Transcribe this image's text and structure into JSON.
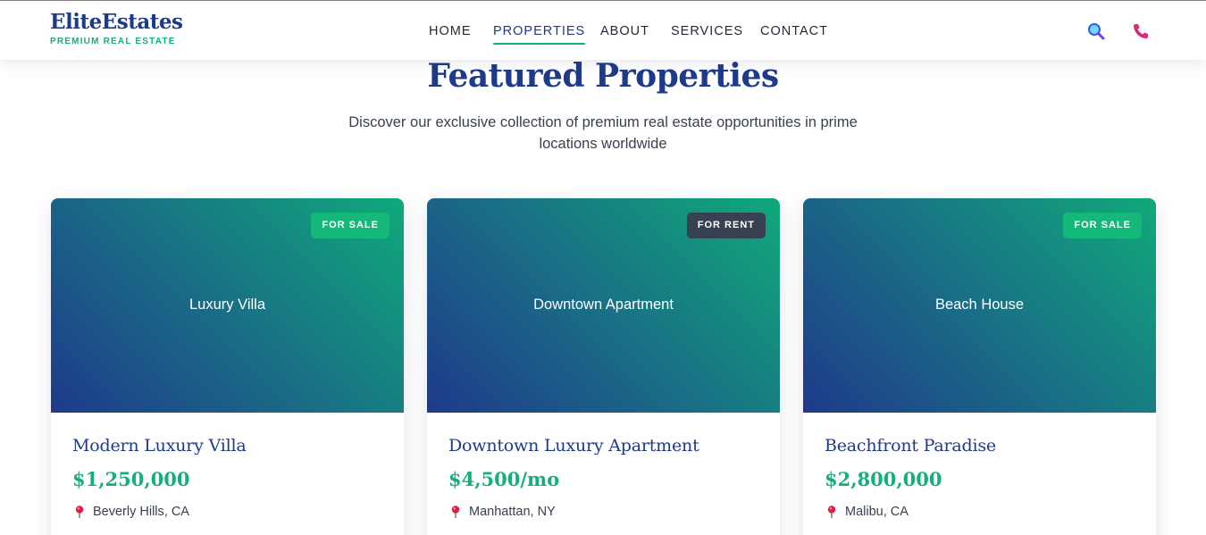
{
  "brand": {
    "name": "EliteEstates",
    "tagline": "PREMIUM REAL ESTATE"
  },
  "nav": {
    "items": [
      {
        "label": "HOME",
        "active": false
      },
      {
        "label": "PROPERTIES",
        "active": true
      },
      {
        "label": "ABOUT",
        "active": false
      },
      {
        "label": "SERVICES",
        "active": false
      },
      {
        "label": "CONTACT",
        "active": false
      }
    ],
    "icons": [
      "search-icon",
      "phone-icon"
    ]
  },
  "section": {
    "title": "Featured Properties",
    "description": "Discover our exclusive collection of premium real estate opportunities in prime locations worldwide"
  },
  "properties": [
    {
      "image_label": "Luxury Villa",
      "badge": "FOR SALE",
      "title": "Modern Luxury Villa",
      "price": "$1,250,000",
      "location": "Beverly Hills, CA"
    },
    {
      "image_label": "Downtown Apartment",
      "badge": "FOR RENT",
      "title": "Downtown Luxury Apartment",
      "price": "$4,500/mo",
      "location": "Manhattan, NY"
    },
    {
      "image_label": "Beach House",
      "badge": "FOR SALE",
      "title": "Beachfront Paradise",
      "price": "$2,800,000",
      "location": "Malibu, CA"
    }
  ],
  "colors": {
    "primary": "#1e3a8a",
    "accent": "#14b07a",
    "sale_badge": "#14b879",
    "rent_badge": "#374151",
    "phone_icon": "#db2777"
  }
}
